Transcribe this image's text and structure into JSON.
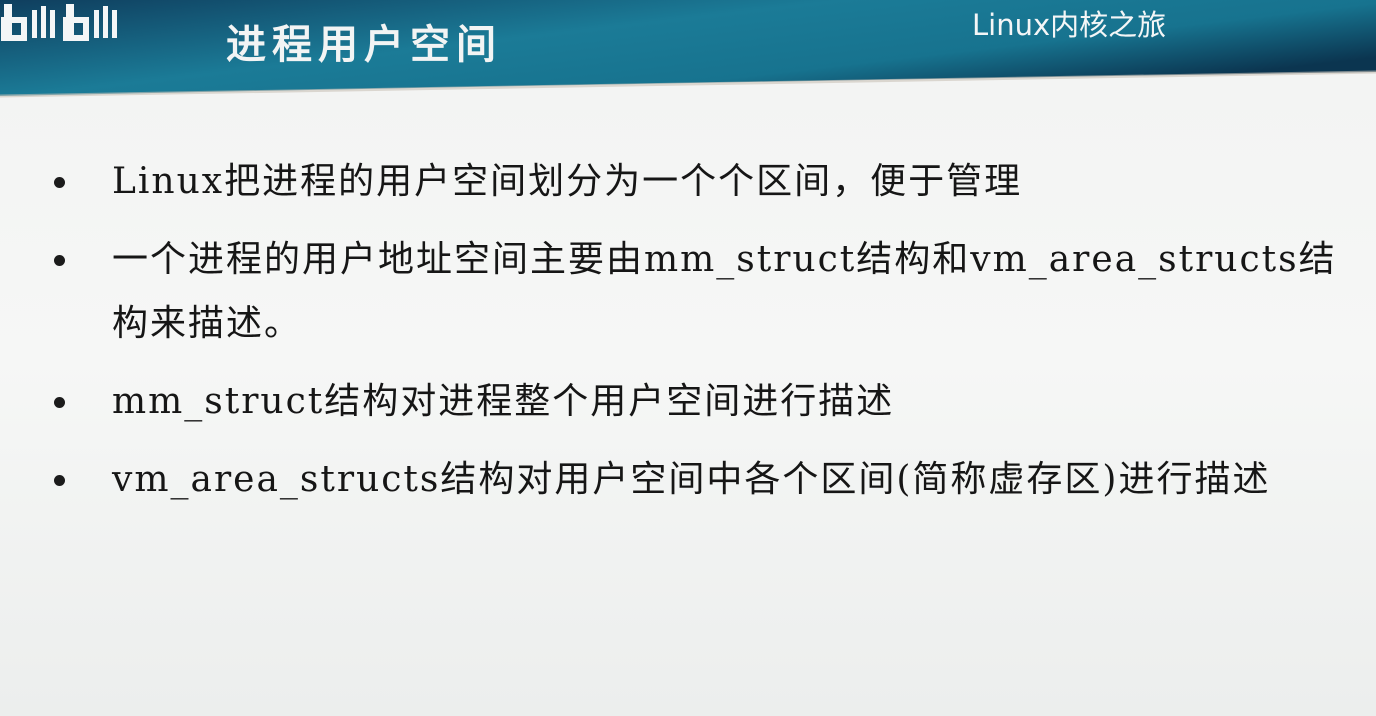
{
  "header": {
    "title": "进程用户空间",
    "watermark": "Linux内核之旅",
    "logo": "bilibili"
  },
  "colors": {
    "header_dark": "#0d3c5a",
    "header_light": "#1f8aa2",
    "text": "#161616"
  },
  "bullets": [
    "Linux把进程的用户空间划分为一个个区间，便于管理",
    "一个进程的用户地址空间主要由mm_struct结构和vm_area_structs结构来描述。",
    "mm_struct结构对进程整个用户空间进行描述",
    "vm_area_structs结构对用户空间中各个区间(简称虚存区)进行描述"
  ]
}
